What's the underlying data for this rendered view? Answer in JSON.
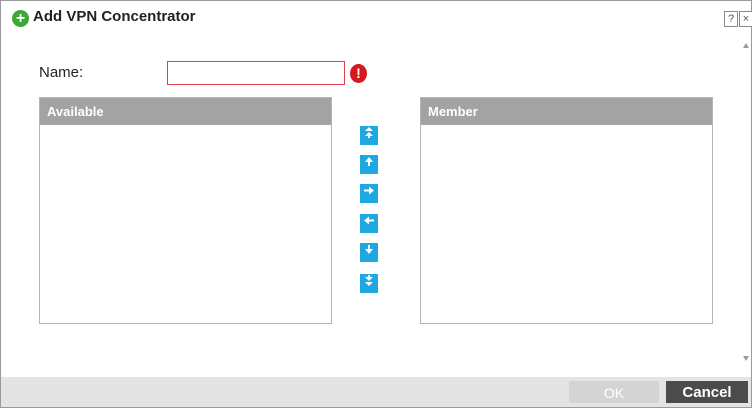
{
  "dialog": {
    "title": "Add VPN Concentrator",
    "title_icon": "add-circle-icon",
    "help_label": "?",
    "close_label": "×"
  },
  "form": {
    "name_label": "Name:",
    "name_value": "",
    "name_placeholder": "",
    "error_glyph": "!"
  },
  "lists": {
    "available_header": "Available",
    "member_header": "Member",
    "available_items": [],
    "member_items": []
  },
  "move_buttons": [
    {
      "name": "move-all-up-button",
      "icon": "double-arrow-up-icon"
    },
    {
      "name": "move-up-button",
      "icon": "arrow-up-icon"
    },
    {
      "name": "add-to-member-button",
      "icon": "arrow-right-icon"
    },
    {
      "name": "remove-from-member-button",
      "icon": "arrow-left-icon"
    },
    {
      "name": "move-down-button",
      "icon": "arrow-down-icon"
    },
    {
      "name": "move-all-down-button",
      "icon": "double-arrow-down-icon"
    }
  ],
  "footer": {
    "ok_label": "OK",
    "cancel_label": "Cancel"
  },
  "colors": {
    "accent": "#1ea7e1",
    "header_gray": "#a3a3a3",
    "error_red": "#d7191f",
    "add_green": "#3aa935",
    "cancel_dark": "#4b4b4b",
    "ok_disabled": "#d4d4d4"
  }
}
